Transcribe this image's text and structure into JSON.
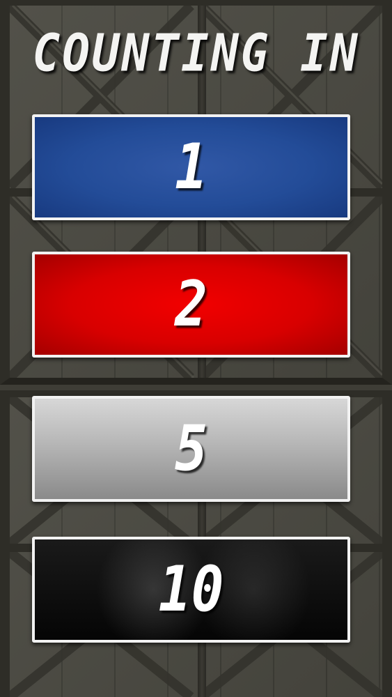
{
  "screen": {
    "title": "COUNTING IN"
  },
  "options": [
    {
      "label": "1",
      "color": "#234c98"
    },
    {
      "label": "2",
      "color": "#d80000"
    },
    {
      "label": "5",
      "color": "#b6b6b6"
    },
    {
      "label": "10",
      "color": "#0a0a0a"
    }
  ],
  "background": {
    "style": "metal-crate",
    "color": "#4b4a42"
  }
}
